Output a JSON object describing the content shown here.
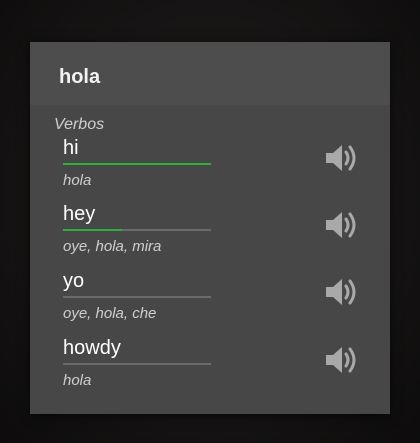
{
  "dialog": {
    "title": "hola",
    "section_label": "Verbos",
    "entries": [
      {
        "word": "hi",
        "meaning": "hola",
        "progress": 1.0,
        "speaker_icon": "speaker-icon"
      },
      {
        "word": "hey",
        "meaning": "oye, hola, mira",
        "progress": 0.4,
        "speaker_icon": "speaker-icon"
      },
      {
        "word": "yo",
        "meaning": "oye, hola, che",
        "progress": 0.0,
        "speaker_icon": "speaker-icon"
      },
      {
        "word": "howdy",
        "meaning": "hola",
        "progress": 0.0,
        "speaker_icon": "speaker-icon"
      }
    ]
  },
  "colors": {
    "dialog_bg": "#474747",
    "header_bg": "#4d4d4d",
    "progress_green": "#2fae3a",
    "icon_gray": "#a9a9a9"
  }
}
